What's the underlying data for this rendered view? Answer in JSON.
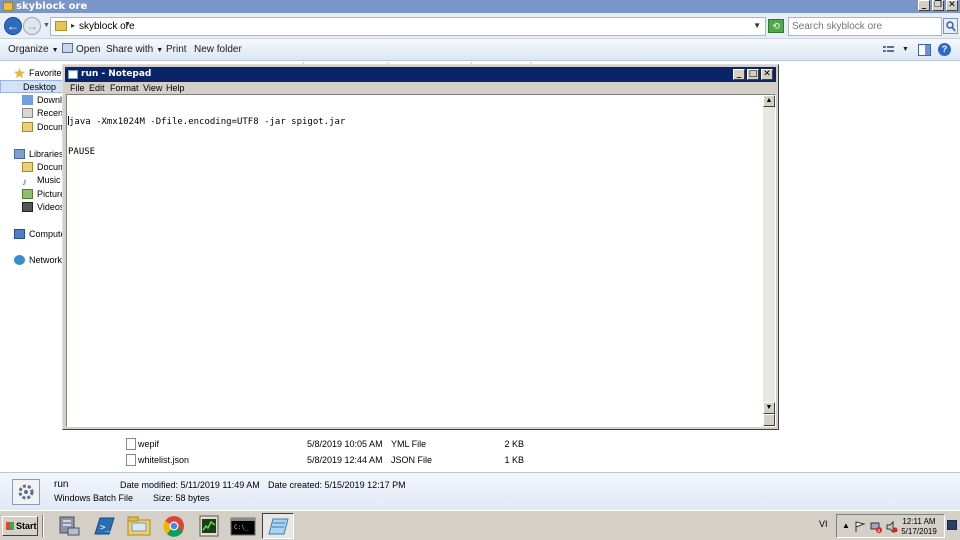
{
  "explorer": {
    "title": "skyblock ore",
    "breadcrumb": "skyblock ore",
    "search_placeholder": "Search skyblock ore",
    "toolbar": {
      "organize": "Organize",
      "open": "Open",
      "share_with": "Share with",
      "print": "Print",
      "new_folder": "New folder"
    },
    "nav": {
      "favorites": "Favorites",
      "desktop": "Desktop",
      "downloads": "Downloads",
      "recent": "Recent",
      "documents_fav": "Documents",
      "libraries": "Libraries",
      "documents": "Documents",
      "music": "Music",
      "pictures": "Pictures",
      "videos": "Videos",
      "computer": "Computer",
      "network": "Network"
    },
    "files": [
      {
        "name": "wepif",
        "date": "5/8/2019 10:05 AM",
        "type": "YML File",
        "size": "2 KB"
      },
      {
        "name": "whitelist.json",
        "date": "5/8/2019 12:44 AM",
        "type": "JSON File",
        "size": "1 KB"
      }
    ],
    "details": {
      "name": "run",
      "kind": "Windows Batch File",
      "date_modified": "Date modified: 5/11/2019 11:49 AM",
      "size": "Size: 58 bytes",
      "date_created": "Date created: 5/15/2019 12:17 PM"
    }
  },
  "notepad": {
    "title": "run - Notepad",
    "menu": {
      "file": "File",
      "edit": "Edit",
      "format": "Format",
      "view": "View",
      "help": "Help"
    },
    "lines": [
      "java -Xmx1024M -Dfile.encoding=UTF8 -jar spigot.jar",
      "PAUSE"
    ]
  },
  "taskbar": {
    "start": "Start",
    "lang": "VI",
    "time": "12:11 AM",
    "date": "5/17/2019"
  },
  "icons": [
    "start-flag-icon",
    "server-manager-icon",
    "powershell-icon",
    "file-explorer-icon",
    "chrome-icon",
    "task-manager-icon",
    "cmd-icon",
    "notepad-icon"
  ]
}
